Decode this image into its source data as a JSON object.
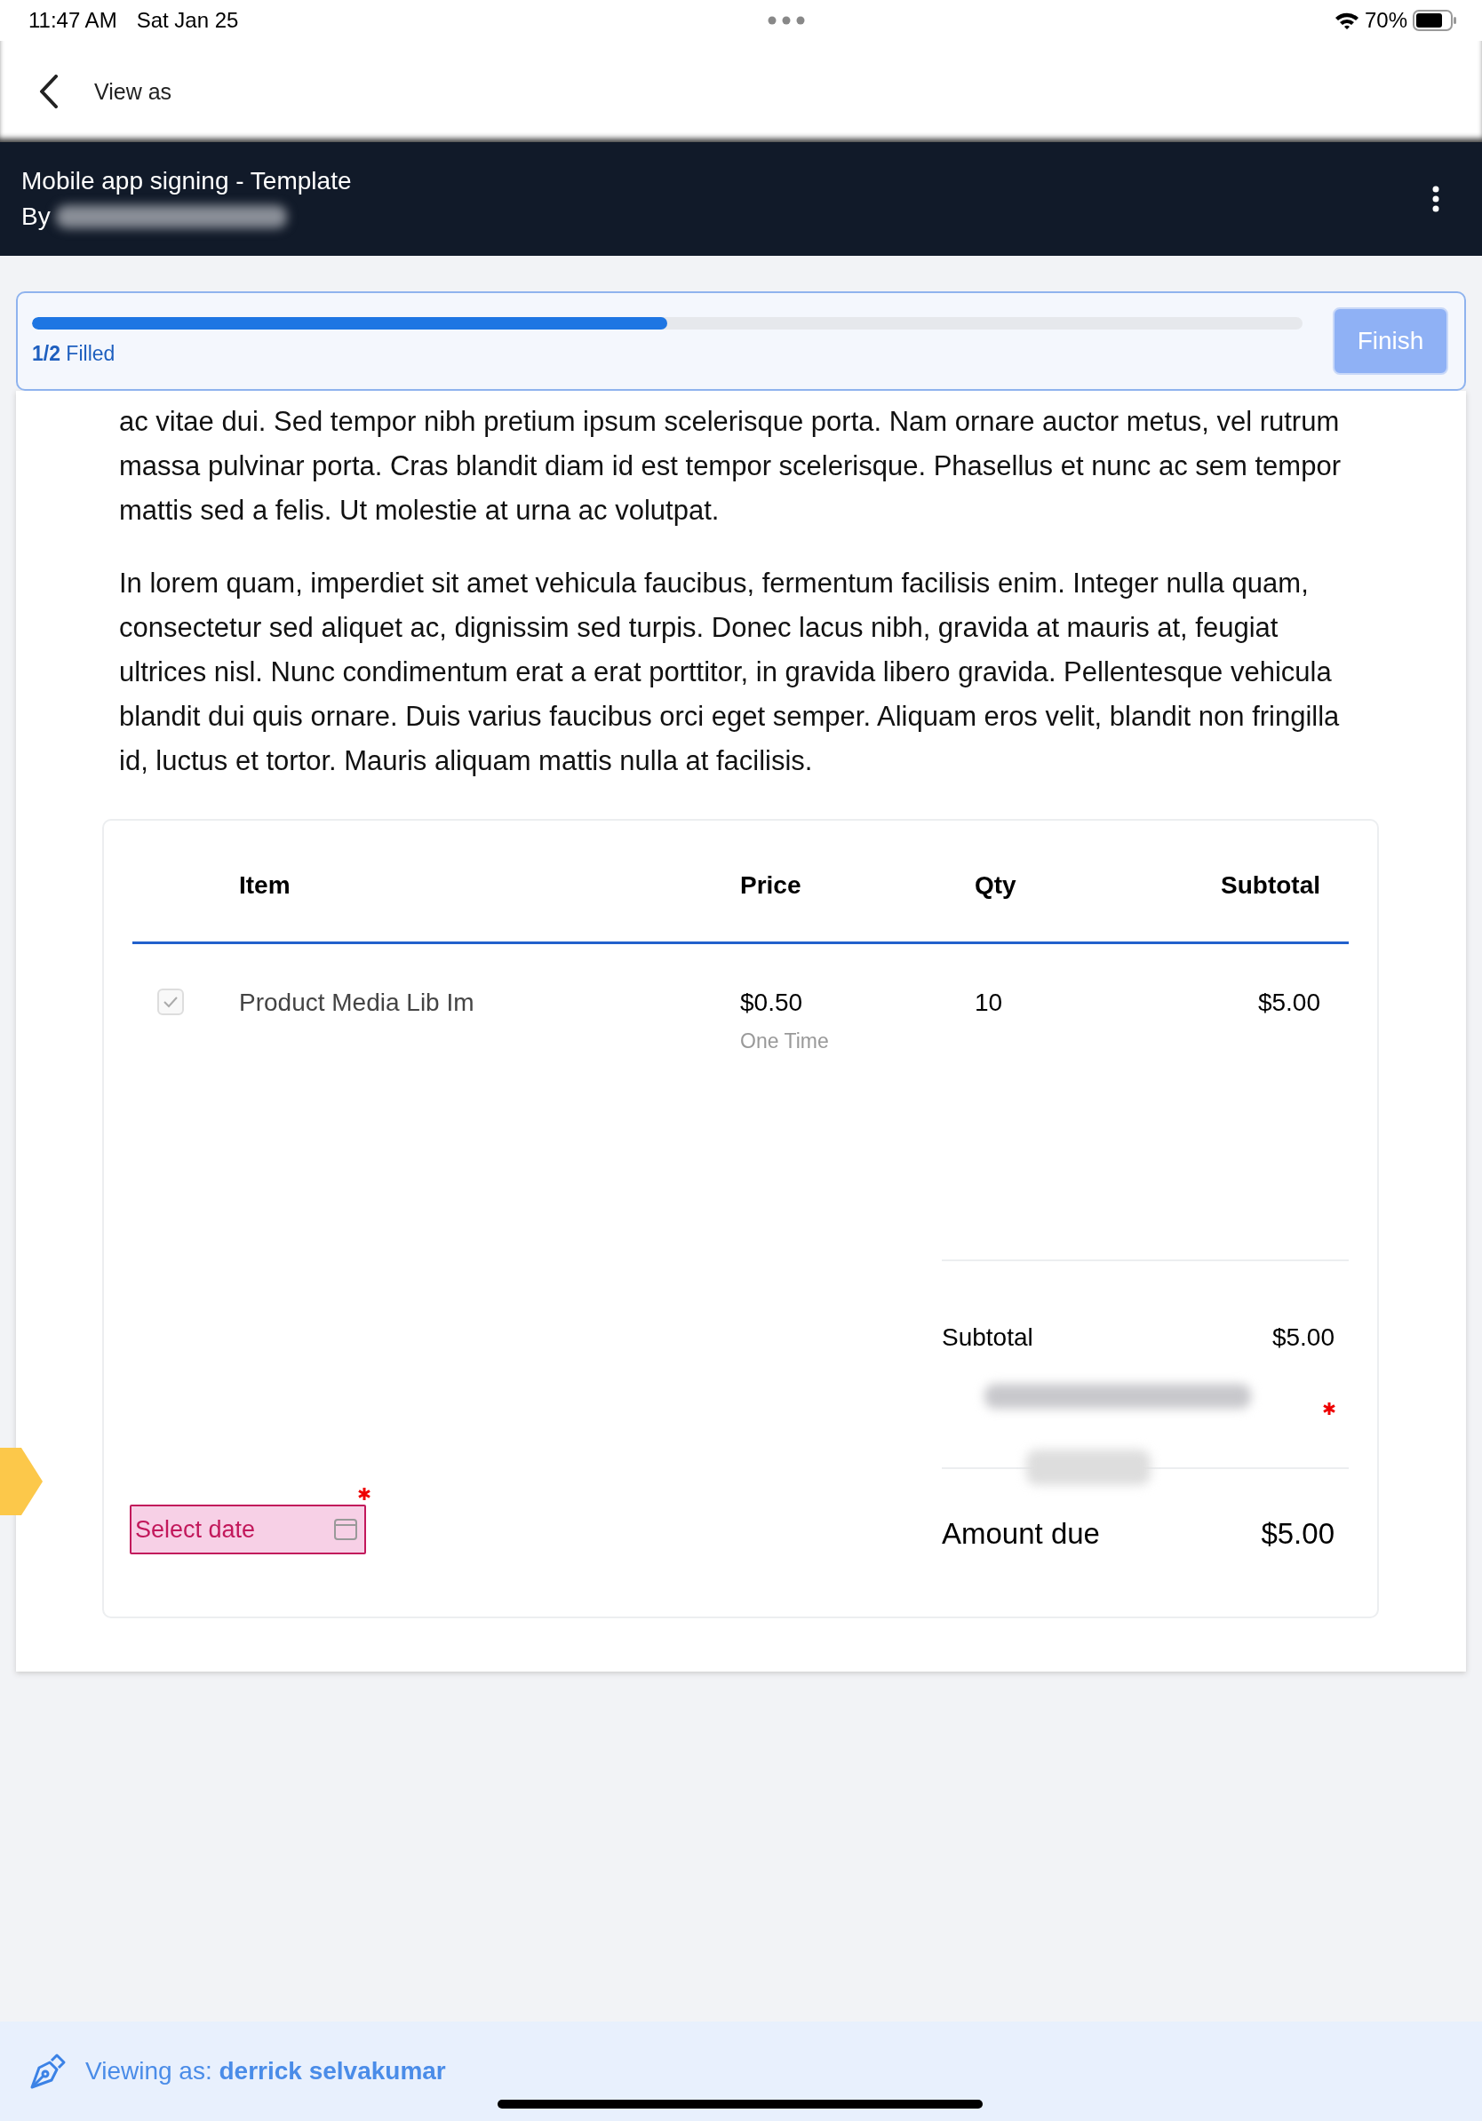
{
  "status_bar": {
    "time": "11:47 AM",
    "date": "Sat Jan 25",
    "battery": "70%"
  },
  "nav": {
    "title": "View as"
  },
  "header": {
    "title": "Mobile app signing - Template",
    "by": "By"
  },
  "progress": {
    "level": 0.5,
    "count": "1/2",
    "label": "Filled",
    "finish": {
      "label": "Finish",
      "disabled": true
    }
  },
  "paragraphs": [
    "ac vitae dui. Sed tempor nibh pretium ipsum scelerisque porta. Nam ornare auctor metus, vel rutrum massa pulvinar porta. Cras blandit diam id est tempor scelerisque. Phasellus et nunc ac sem tempor mattis sed a felis. Ut molestie at urna ac volutpat.",
    "In lorem quam, imperdiet sit amet vehicula faucibus, fermentum facilisis enim. Integer nulla quam, consectetur sed aliquet ac, dignissim sed turpis. Donec lacus nibh, gravida at mauris at, feugiat ultrices nisl. Nunc condimentum erat a erat porttitor, in gravida libero gravida. Pellentesque vehicula blandit dui quis ornare. Duis varius faucibus orci eget semper. Aliquam eros velit, blandit non fringilla id, luctus et tortor. Mauris aliquam mattis nulla at facilisis."
  ],
  "table": {
    "columns": [
      "Item",
      "Price",
      "Qty",
      "Subtotal"
    ],
    "rows": [
      {
        "checked": true,
        "item": "Product Media Lib Im",
        "price": "$0.50",
        "price_note": "One Time",
        "qty": "10",
        "subtotal": "$5.00"
      }
    ]
  },
  "totals": {
    "subtotal_label": "Subtotal",
    "subtotal_value": "$5.00",
    "signature_required": true,
    "amount_due_label": "Amount due",
    "amount_due_value": "$5.00"
  },
  "date_field": {
    "placeholder": "Select date",
    "required": true
  },
  "footer": {
    "text": "Viewing as: **derrick selvakumar**"
  }
}
